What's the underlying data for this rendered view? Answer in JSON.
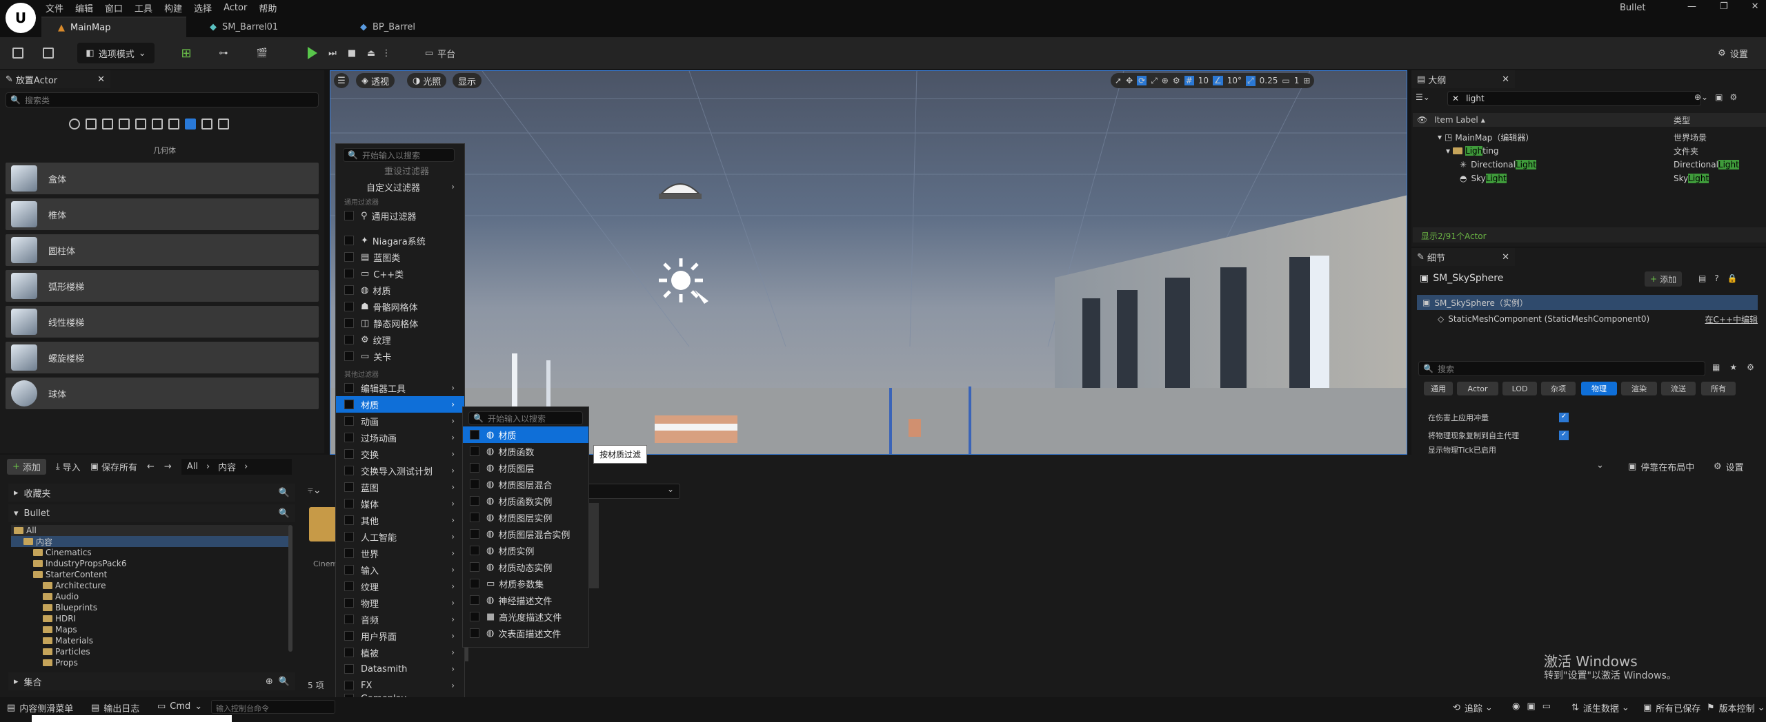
{
  "app": {
    "title": "Bullet",
    "menu": [
      "文件",
      "编辑",
      "窗口",
      "工具",
      "构建",
      "选择",
      "Actor",
      "帮助"
    ],
    "window_controls": [
      "—",
      "❐",
      "✕"
    ]
  },
  "tabs": [
    {
      "label": "MainMap"
    },
    {
      "label": "SM_Barrel01"
    },
    {
      "label": "BP_Barrel"
    }
  ],
  "toolbar": {
    "mode": "选项模式",
    "platform": "平台",
    "settings": "设置"
  },
  "place_actor": {
    "title": "放置Actor",
    "search_placeholder": "搜索类",
    "category": "几何体",
    "items": [
      "盒体",
      "椎体",
      "圆柱体",
      "弧形楼梯",
      "线性楼梯",
      "螺旋楼梯",
      "球体"
    ]
  },
  "viewport": {
    "perspective": "透视",
    "lit": "光照",
    "show": "显示",
    "grid": "10",
    "angle": "10°",
    "scale": "0.25",
    "cam": "1"
  },
  "filter_menu": {
    "search_placeholder": "开始输入以搜索",
    "reset": "重设过滤器",
    "custom": "自定义过滤器",
    "common_section": "通用过滤器",
    "common": "通用过滤器",
    "types": [
      "Niagara系统",
      "蓝图类",
      "C++类",
      "材质",
      "骨骼网格体",
      "静态网格体",
      "纹理",
      "关卡"
    ],
    "other_section": "其他过滤器",
    "submenus": [
      "编辑器工具",
      "材质",
      "动画",
      "过场动画",
      "交换",
      "交换导入测试计划",
      "蓝图",
      "媒体",
      "其他",
      "人工智能",
      "世界",
      "输入",
      "纹理",
      "物理",
      "音频",
      "用户界面",
      "植被",
      "Datasmith",
      "FX",
      "Gameplay"
    ]
  },
  "material_menu": {
    "search_placeholder": "开始输入以搜索",
    "items": [
      "材质",
      "材质函数",
      "材质图层",
      "材质图层混合",
      "材质函数实例",
      "材质图层实例",
      "材质图层混合实例",
      "材质实例",
      "材质动态实例",
      "材质参数集",
      "神经描述文件",
      "高光度描述文件",
      "次表面描述文件"
    ],
    "tooltip": "按材质过滤"
  },
  "content_browser": {
    "add": "添加",
    "import": "导入",
    "save_all": "保存所有",
    "path": [
      "All",
      "内容"
    ],
    "favorites": "收藏夹",
    "project": "Bullet",
    "collections": "集合",
    "item_count": "5 项",
    "dock": "停靠在布局中",
    "settings": "设置",
    "asset_partial": "Cinem",
    "tree": [
      {
        "label": "All",
        "depth": 0
      },
      {
        "label": "内容",
        "depth": 1
      },
      {
        "label": "Cinematics",
        "depth": 2
      },
      {
        "label": "IndustryPropsPack6",
        "depth": 2
      },
      {
        "label": "StarterContent",
        "depth": 2
      },
      {
        "label": "Architecture",
        "depth": 3
      },
      {
        "label": "Audio",
        "depth": 3
      },
      {
        "label": "Blueprints",
        "depth": 3
      },
      {
        "label": "HDRI",
        "depth": 3
      },
      {
        "label": "Maps",
        "depth": 3
      },
      {
        "label": "Materials",
        "depth": 3
      },
      {
        "label": "Particles",
        "depth": 3
      },
      {
        "label": "Props",
        "depth": 3
      }
    ]
  },
  "outliner": {
    "title": "大纲",
    "search_value": "light",
    "col_label": "Item Label",
    "col_type": "类型",
    "rows": [
      {
        "pre": "MainMap（编辑器）",
        "hl": "",
        "post": "",
        "type": "世界场景",
        "type_hl": "",
        "depth": 0
      },
      {
        "pre": "",
        "hl": "Ligh",
        "post": "ting",
        "type": "文件夹",
        "type_hl": "",
        "depth": 1
      },
      {
        "pre": "Directional",
        "hl": "Light",
        "post": "",
        "type": "Directional",
        "type_hl": "Light",
        "depth": 2
      },
      {
        "pre": "Sky",
        "hl": "Light",
        "post": "",
        "type": "Sky",
        "type_hl": "Light",
        "depth": 2
      }
    ],
    "count": "显示2/91个Actor"
  },
  "details": {
    "title": "细节",
    "actor": "SM_SkySphere",
    "add": "添加",
    "instance": "SM_SkySphere（实例）",
    "component": "StaticMeshComponent (StaticMeshComponent0)",
    "edit_cpp": "在C++中编辑",
    "search_placeholder": "搜索",
    "categories": [
      "通用",
      "Actor",
      "LOD",
      "杂项",
      "物理",
      "渲染",
      "流送",
      "所有"
    ],
    "active_category": "物理",
    "props": [
      "在伤害上应用冲量",
      "将物理现象复制到自主代理",
      "显示物理Tick已启用"
    ]
  },
  "status": {
    "drawer": "内容侧滑菜单",
    "log": "输出日志",
    "cmd": "Cmd",
    "cmd_placeholder": "输入控制台命令",
    "trace": "追踪",
    "derived": "派生数据",
    "saved": "所有已保存",
    "source": "版本控制"
  },
  "watermark": {
    "line1": "激活 Windows",
    "line2": "转到\"设置\"以激活 Windows。"
  }
}
